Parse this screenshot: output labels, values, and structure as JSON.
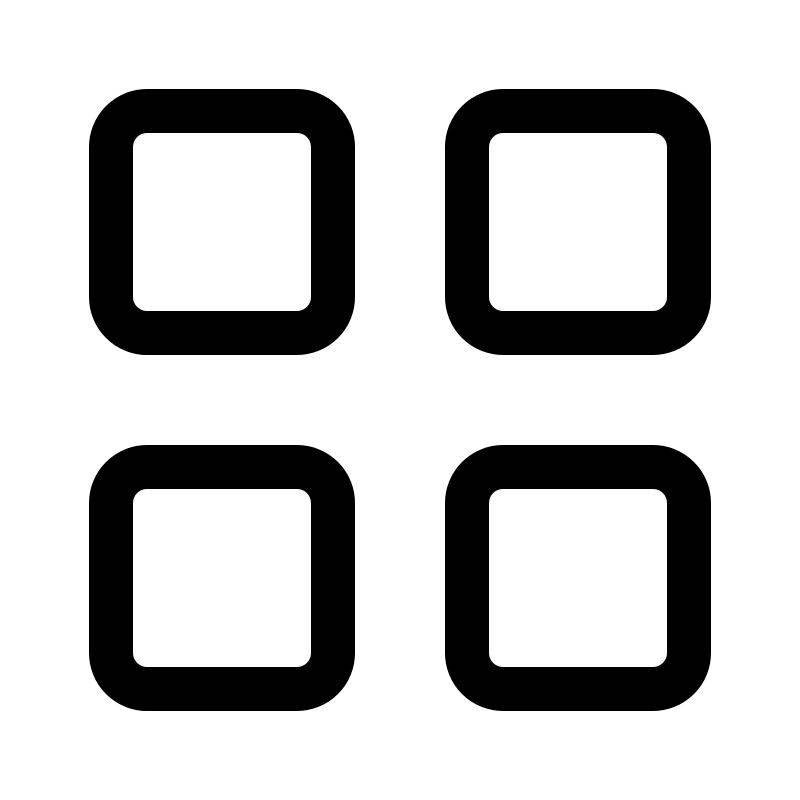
{
  "icon": {
    "name": "grid-icon",
    "description_visible_text": "",
    "tiles": [
      "top-left",
      "top-right",
      "bottom-left",
      "bottom-right"
    ]
  },
  "colors": {
    "background": "#ffffff",
    "stroke": "#000000"
  }
}
